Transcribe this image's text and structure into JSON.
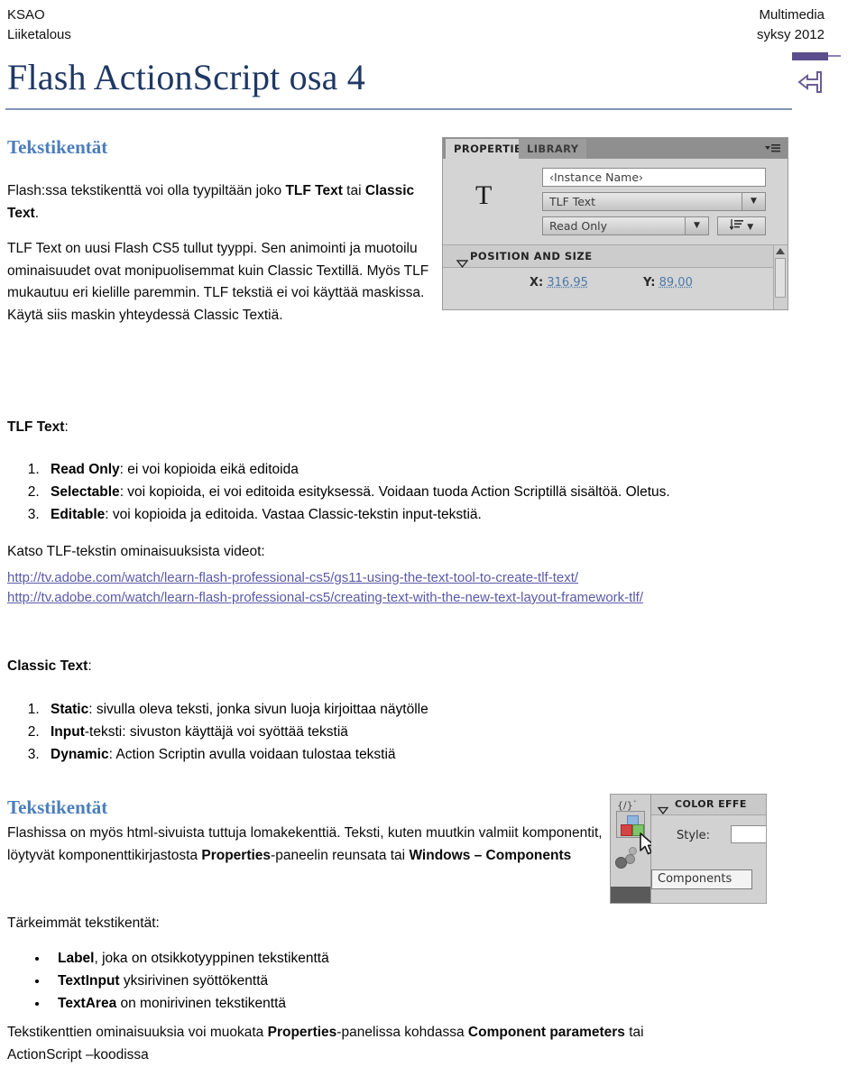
{
  "header": {
    "left_line1": "KSAO",
    "left_line2": "Liiketalous",
    "right_line1": "Multimedia",
    "right_line2": "syksy 2012"
  },
  "title": "Flash ActionScript osa 4",
  "logo": {
    "glyph": "↵"
  },
  "section1": {
    "heading": "Tekstikentät",
    "para1_part1": "Flash:ssa tekstikenttä voi olla tyypiltään joko ",
    "para1_bold1": "TLF Text",
    "para1_part2": " tai ",
    "para1_bold2": "Classic Text",
    "para1_part3": ".",
    "para2": "TLF Text on uusi Flash CS5 tullut tyyppi. Sen animointi ja muotoilu ominaisuudet ovat monipuolisemmat kuin Classic Textillä. Myös TLF mukautuu eri kielille paremmin. TLF tekstiä ei voi käyttää maskissa. Käytä siis maskin yhteydessä Classic Textiä."
  },
  "properties_panel": {
    "tab_active": "PROPERTIES",
    "tab_inactive": "LIBRARY",
    "menu_icon": "panel-menu-icon",
    "type_glyph": "T",
    "instance_name_placeholder": "‹Instance Name›",
    "text_type_value": "TLF Text",
    "edit_mode_value": "Read Only",
    "align_icon": "align-icon",
    "section_title": "POSITION AND SIZE",
    "x_label": "X:",
    "x_value": "316,95",
    "y_label": "Y:",
    "y_value": "89,00"
  },
  "tlf_text": {
    "heading_bold": "TLF Text",
    "heading_suffix": ":",
    "items": [
      {
        "bold": "Read Only",
        "rest": ": ei voi kopioida eikä editoida"
      },
      {
        "bold": "Selectable",
        "rest": ": voi kopioida, ei voi editoida esityksessä. Voidaan tuoda Action Scriptillä sisältöä. Oletus."
      },
      {
        "bold": "Editable",
        "rest": ": voi kopioida ja editoida. Vastaa Classic-tekstin input-tekstiä."
      }
    ]
  },
  "videos": {
    "intro": "Katso TLF-tekstin ominaisuuksista videot:",
    "link1": "http://tv.adobe.com/watch/learn-flash-professional-cs5/gs11-using-the-text-tool-to-create-tlf-text/",
    "link2": "http://tv.adobe.com/watch/learn-flash-professional-cs5/creating-text-with-the-new-text-layout-framework-tlf/"
  },
  "classic_text": {
    "heading_bold": "Classic Text",
    "heading_suffix": ":",
    "items": [
      {
        "bold": "Static",
        "rest": ": sivulla oleva teksti, jonka sivun luoja kirjoittaa näytölle"
      },
      {
        "bold": "Input",
        "rest": "-teksti: sivuston käyttäjä voi syöttää tekstiä"
      },
      {
        "bold": "Dynamic",
        "rest": ": Action Scriptin avulla voidaan tulostaa tekstiä"
      }
    ]
  },
  "section2": {
    "heading": "Tekstikentät",
    "para_part1": "Flashissa on myös html-sivuista tuttuja lomakekenttiä. Teksti, kuten muutkin valmiit komponentit, löytyvät komponenttikirjastosta ",
    "para_bold1": "Properties",
    "para_part2": "-paneelin reunsata tai ",
    "para_bold2": "Windows – Components"
  },
  "components_panel": {
    "rail_top_icon": "code-snippets-icon",
    "components_icon": "components-cubes-icon",
    "cursor_icon": "mouse-cursor-icon",
    "section_title": "COLOR EFFE",
    "style_label": "Style:",
    "tooltip": "Components"
  },
  "important_fields": {
    "intro": "Tärkeimmät tekstikentät:",
    "items": [
      {
        "bold": "Label",
        "rest": ", joka on otsikkotyyppinen tekstikenttä"
      },
      {
        "bold": "TextInput",
        "rest": " yksirivinen syöttökenttä"
      },
      {
        "bold": "TextArea",
        "rest": " on monirivinen tekstikenttä"
      }
    ],
    "closing_part1": "Tekstikenttien ominaisuuksia voi muokata ",
    "closing_bold1": "Properties",
    "closing_part2": "-panelissa kohdassa ",
    "closing_bold2": "Component parameters",
    "closing_part3": " tai",
    "closing_line2": "ActionScript –koodissa"
  },
  "colors": {
    "title": "#1F3864",
    "heading_blue": "#4A7EBB",
    "rule": "#8196B5",
    "link": "#5A5AA8",
    "logo_purple": "#5B4E8C"
  }
}
